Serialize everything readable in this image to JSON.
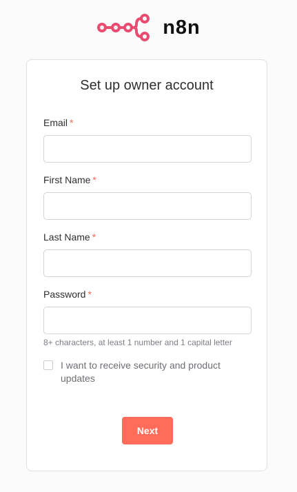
{
  "brand": {
    "name": "n8n",
    "logo_icon": "n8n-nodes-icon",
    "accent_color": "#ea4b71"
  },
  "form": {
    "title": "Set up owner account",
    "required_marker": "*",
    "fields": [
      {
        "label": "Email",
        "value": "",
        "placeholder": ""
      },
      {
        "label": "First Name",
        "value": "",
        "placeholder": ""
      },
      {
        "label": "Last Name",
        "value": "",
        "placeholder": ""
      },
      {
        "label": "Password",
        "value": "",
        "placeholder": ""
      }
    ],
    "password_hint": "8+ characters, at least 1 number and 1 capital letter",
    "updates_checkbox": {
      "label": "I want to receive security and product updates",
      "checked": false
    },
    "next_label": "Next",
    "button_color": "#ff6d5a"
  }
}
